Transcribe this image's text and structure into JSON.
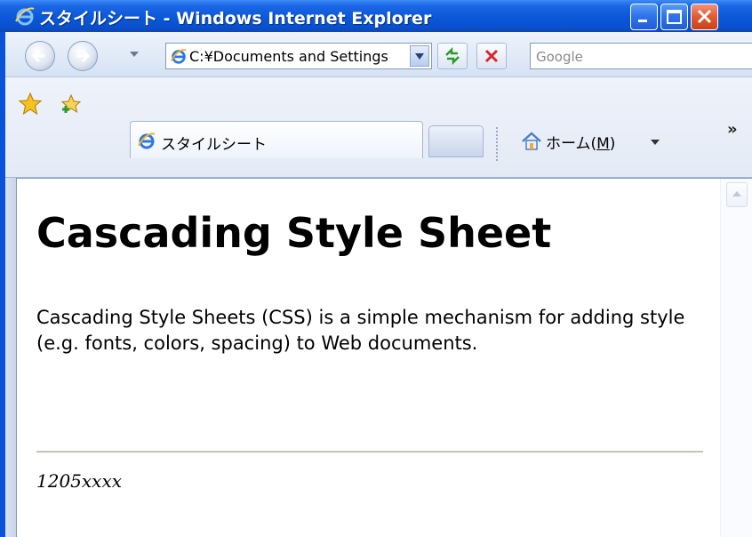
{
  "window": {
    "title": "スタイルシート - Windows Internet Explorer"
  },
  "address_bar": {
    "url": "C:¥Documents and Settings"
  },
  "search": {
    "placeholder": "Google"
  },
  "tab": {
    "label": "スタイルシート"
  },
  "favorites_bar": {
    "home_label": "ホーム(",
    "home_accel": "M",
    "home_close": ")",
    "more": "»"
  },
  "page": {
    "heading": "Cascading Style Sheet",
    "paragraph": "Cascading Style Sheets (CSS) is a simple mechanism for adding style (e.g. fonts, colors, spacing) to Web documents.",
    "footer": "1205xxxx"
  },
  "colors": {
    "titlebar": "#0b58d8",
    "close_button": "#e15a30",
    "hr": "#c8c2b0"
  }
}
